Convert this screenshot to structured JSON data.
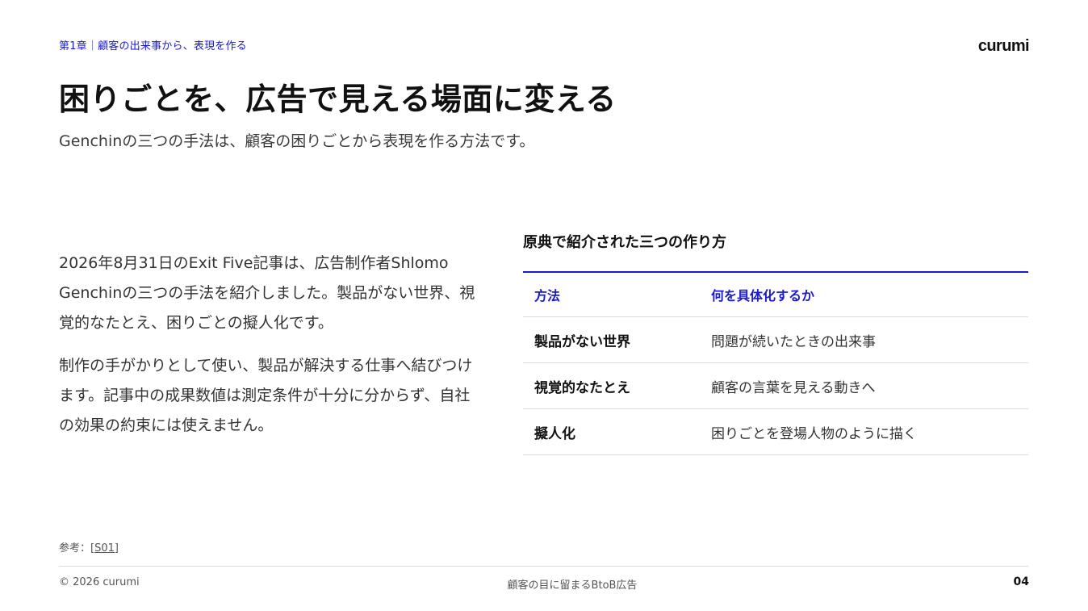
{
  "header": {
    "chapter_label": "第1章｜顧客の出来事から、表現を作る",
    "logo_text": "curumi"
  },
  "title": "困りごとを、広告で見える場面に変える",
  "subtitle": "Genchinの三つの手法は、顧客の困りごとから表現を作る方法です。",
  "body": {
    "paragraphs": [
      "2026年8月31日のExit Five記事は、広告制作者Shlomo Genchinの三つの手法を紹介しました。製品がない世界、視覚的なたとえ、困りごとの擬人化です。",
      "制作の手がかりとして使い、製品が解決する仕事へ結びつけます。記事中の成果数値は測定条件が十分に分からず、自社の効果の約束には使えません。"
    ]
  },
  "table": {
    "caption": "原典で紹介された三つの作り方",
    "headers": [
      "方法",
      "何を具体化するか"
    ],
    "rows": [
      {
        "method": "製品がない世界",
        "description": "問題が続いたときの出来事"
      },
      {
        "method": "視覚的なたとえ",
        "description": "顧客の言葉を見える動きへ"
      },
      {
        "method": "擬人化",
        "description": "困りごとを登場人物のように描く"
      }
    ]
  },
  "reference": {
    "prefix": "参考：",
    "link_text": "[S01]"
  },
  "footer": {
    "copyright": "© 2026 curumi",
    "center_text": "顧客の目に留まるBtoB広告",
    "page_number": "04"
  },
  "colors": {
    "accent": "#1a1acc",
    "text": "#1a1a1a",
    "muted": "#555555",
    "rule": "#dcdcdc"
  }
}
